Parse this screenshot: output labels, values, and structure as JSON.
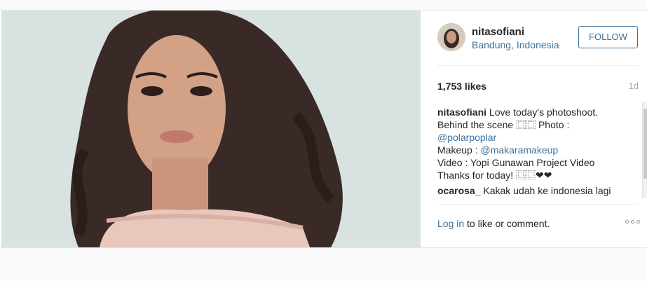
{
  "header": {
    "username": "nitasofiani",
    "location": "Bandung, Indonesia",
    "follow_label": "FOLLOW"
  },
  "stats": {
    "likes": "1,753 likes",
    "time": "1d"
  },
  "caption": {
    "username": "nitasofiani",
    "line1_text": " Love today's photoshoot.",
    "line2_text": "Behind the scene ⿴⿴ Photo :",
    "line3_mention": "@polarpoplar",
    "line4_text": "Makeup : ",
    "line4_mention": "@makaramakeup",
    "line5_text": "Video : Yopi Gunawan Project Video",
    "line6_text": "Thanks for today! ⿴⿴❤❤"
  },
  "comment": {
    "username": "ocarosa_",
    "text": " Kakak udah ke indonesia lagi"
  },
  "footer": {
    "login_link": "Log in",
    "login_rest": " to like or comment."
  },
  "icons": {
    "more": "more-options-icon",
    "avatar": "avatar"
  },
  "colors": {
    "link": "#3f729b",
    "muted": "#a5a7aa"
  }
}
